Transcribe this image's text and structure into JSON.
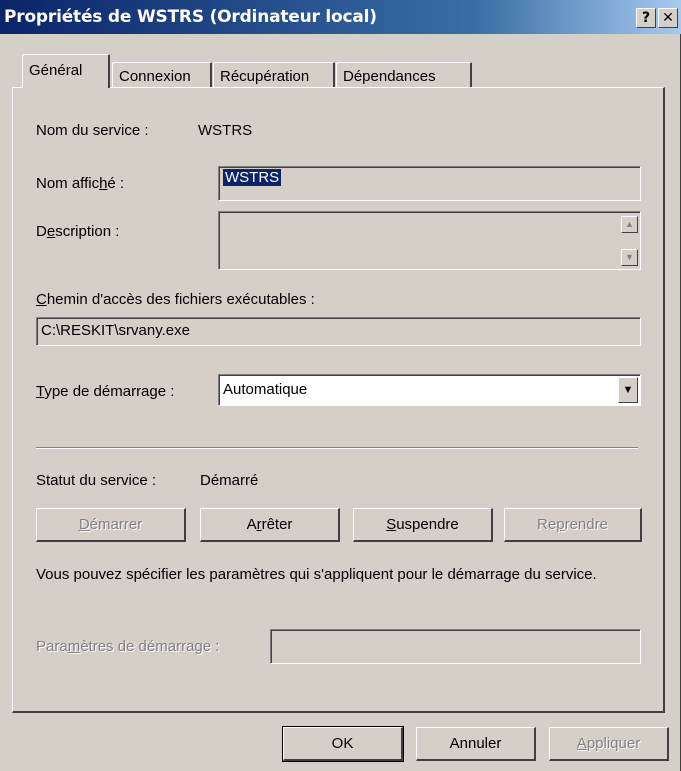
{
  "window": {
    "title": "Propriétés de WSTRS (Ordinateur local)",
    "help_glyph": "?",
    "close_glyph": "✕"
  },
  "tabs": [
    {
      "label": "Général",
      "active": true
    },
    {
      "label": "Connexion"
    },
    {
      "label": "Récupération"
    },
    {
      "label": "Dépendances"
    }
  ],
  "general": {
    "service_name_label": "Nom du service :",
    "service_name_value": "WSTRS",
    "display_name_label_pre": "Nom affic",
    "display_name_label_ul": "h",
    "display_name_label_post": "é :",
    "display_name_value": "WSTRS",
    "description_label_pre": "D",
    "description_label_ul": "e",
    "description_label_post": "scription :",
    "description_value": "",
    "path_label_ul": "C",
    "path_label_post": "hemin d'accès des fichiers exécutables :",
    "path_value": "C:\\RESKIT\\srvany.exe",
    "startup_label_ul": "T",
    "startup_label_post": "ype de démarrage :",
    "startup_value": "Automatique",
    "status_label": "Statut du service :",
    "status_value": "Démarré",
    "info_text": "Vous pouvez spécifier les paramètres qui s'appliquent pour le démarrage du service.",
    "params_label_pre": "Para",
    "params_label_ul": "m",
    "params_label_post": "ètres de démarrage :",
    "params_value": ""
  },
  "service_buttons": {
    "start_ul": "D",
    "start_rest": "émarrer",
    "stop_pre": "A",
    "stop_ul": "r",
    "stop_rest": "rêter",
    "pause_ul": "S",
    "pause_rest": "uspendre",
    "resume_pre": "Re",
    "resume_ul": "p",
    "resume_rest": "rendre"
  },
  "dialog_buttons": {
    "ok": "OK",
    "cancel": "Annuler",
    "apply_ul": "A",
    "apply_rest": "ppliquer"
  }
}
